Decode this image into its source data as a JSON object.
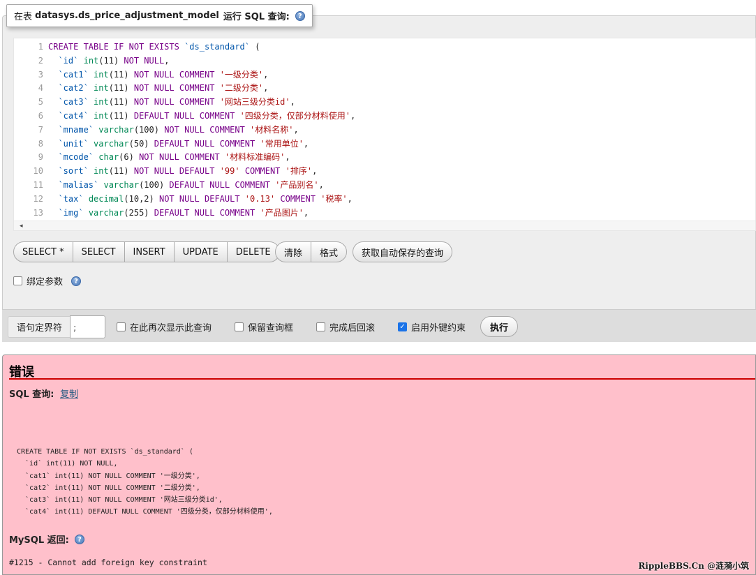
{
  "query_panel": {
    "legend_prefix": "在表",
    "table_name": "datasys.ds_price_adjustment_model",
    "legend_suffix": "运行 SQL 查询:",
    "help_icon": "help-icon"
  },
  "editor": {
    "lines": [
      {
        "n": "1",
        "t": [
          [
            "kw",
            "CREATE TABLE IF NOT EXISTS "
          ],
          [
            "idn",
            "`ds_standard`"
          ],
          [
            "pl",
            " ("
          ]
        ]
      },
      {
        "n": "2",
        "t": [
          [
            "pl",
            "  "
          ],
          [
            "idn",
            "`id`"
          ],
          [
            "pl",
            " "
          ],
          [
            "ty",
            "int"
          ],
          [
            "pl",
            "(11) "
          ],
          [
            "kw",
            "NOT NULL"
          ],
          [
            "pl",
            ","
          ]
        ]
      },
      {
        "n": "3",
        "t": [
          [
            "pl",
            "  "
          ],
          [
            "idn",
            "`cat1`"
          ],
          [
            "pl",
            " "
          ],
          [
            "ty",
            "int"
          ],
          [
            "pl",
            "(11) "
          ],
          [
            "kw",
            "NOT NULL COMMENT "
          ],
          [
            "str",
            "'一级分类'"
          ],
          [
            "pl",
            ","
          ]
        ]
      },
      {
        "n": "4",
        "t": [
          [
            "pl",
            "  "
          ],
          [
            "idn",
            "`cat2`"
          ],
          [
            "pl",
            " "
          ],
          [
            "ty",
            "int"
          ],
          [
            "pl",
            "(11) "
          ],
          [
            "kw",
            "NOT NULL COMMENT "
          ],
          [
            "str",
            "'二级分类'"
          ],
          [
            "pl",
            ","
          ]
        ]
      },
      {
        "n": "5",
        "t": [
          [
            "pl",
            "  "
          ],
          [
            "idn",
            "`cat3`"
          ],
          [
            "pl",
            " "
          ],
          [
            "ty",
            "int"
          ],
          [
            "pl",
            "(11) "
          ],
          [
            "kw",
            "NOT NULL COMMENT "
          ],
          [
            "str",
            "'网站三级分类id'"
          ],
          [
            "pl",
            ","
          ]
        ]
      },
      {
        "n": "6",
        "t": [
          [
            "pl",
            "  "
          ],
          [
            "idn",
            "`cat4`"
          ],
          [
            "pl",
            " "
          ],
          [
            "ty",
            "int"
          ],
          [
            "pl",
            "(11) "
          ],
          [
            "kw",
            "DEFAULT NULL COMMENT "
          ],
          [
            "str",
            "'四级分类，仅部分材料使用'"
          ],
          [
            "pl",
            ","
          ]
        ]
      },
      {
        "n": "7",
        "t": [
          [
            "pl",
            "  "
          ],
          [
            "idn",
            "`mname`"
          ],
          [
            "pl",
            " "
          ],
          [
            "ty",
            "varchar"
          ],
          [
            "pl",
            "(100) "
          ],
          [
            "kw",
            "NOT NULL COMMENT "
          ],
          [
            "str",
            "'材料名称'"
          ],
          [
            "pl",
            ","
          ]
        ]
      },
      {
        "n": "8",
        "t": [
          [
            "pl",
            "  "
          ],
          [
            "idn",
            "`unit`"
          ],
          [
            "pl",
            " "
          ],
          [
            "ty",
            "varchar"
          ],
          [
            "pl",
            "(50) "
          ],
          [
            "kw",
            "DEFAULT NULL COMMENT "
          ],
          [
            "str",
            "'常用单位'"
          ],
          [
            "pl",
            ","
          ]
        ]
      },
      {
        "n": "9",
        "t": [
          [
            "pl",
            "  "
          ],
          [
            "idn",
            "`mcode`"
          ],
          [
            "pl",
            " "
          ],
          [
            "ty",
            "char"
          ],
          [
            "pl",
            "(6) "
          ],
          [
            "kw",
            "NOT NULL COMMENT "
          ],
          [
            "str",
            "'材料标准编码'"
          ],
          [
            "pl",
            ","
          ]
        ]
      },
      {
        "n": "10",
        "t": [
          [
            "pl",
            "  "
          ],
          [
            "idn",
            "`sort`"
          ],
          [
            "pl",
            " "
          ],
          [
            "ty",
            "int"
          ],
          [
            "pl",
            "(11) "
          ],
          [
            "kw",
            "NOT NULL DEFAULT "
          ],
          [
            "str",
            "'99'"
          ],
          [
            "kw",
            " COMMENT "
          ],
          [
            "str",
            "'排序'"
          ],
          [
            "pl",
            ","
          ]
        ]
      },
      {
        "n": "11",
        "t": [
          [
            "pl",
            "  "
          ],
          [
            "idn",
            "`malias`"
          ],
          [
            "pl",
            " "
          ],
          [
            "ty",
            "varchar"
          ],
          [
            "pl",
            "(100) "
          ],
          [
            "kw",
            "DEFAULT NULL COMMENT "
          ],
          [
            "str",
            "'产品别名'"
          ],
          [
            "pl",
            ","
          ]
        ]
      },
      {
        "n": "12",
        "t": [
          [
            "pl",
            "  "
          ],
          [
            "idn",
            "`tax`"
          ],
          [
            "pl",
            " "
          ],
          [
            "ty",
            "decimal"
          ],
          [
            "pl",
            "(10,2) "
          ],
          [
            "kw",
            "NOT NULL DEFAULT "
          ],
          [
            "str",
            "'0.13'"
          ],
          [
            "kw",
            " COMMENT "
          ],
          [
            "str",
            "'税率'"
          ],
          [
            "pl",
            ","
          ]
        ]
      },
      {
        "n": "13",
        "t": [
          [
            "pl",
            "  "
          ],
          [
            "idn",
            "`img`"
          ],
          [
            "pl",
            " "
          ],
          [
            "ty",
            "varchar"
          ],
          [
            "pl",
            "(255) "
          ],
          [
            "kw",
            "DEFAULT NULL COMMENT "
          ],
          [
            "str",
            "'产品图片'"
          ],
          [
            "pl",
            ","
          ]
        ]
      }
    ],
    "scroll_arrow": "◂"
  },
  "buttons": {
    "select_star": "SELECT *",
    "select": "SELECT",
    "insert": "INSERT",
    "update": "UPDATE",
    "delete": "DELETE",
    "clear": "清除",
    "format": "格式",
    "get_autosaved": "获取自动保存的查询"
  },
  "bind_params": {
    "label": "绑定参数",
    "checked": false
  },
  "bottom_bar": {
    "delimiter_label": "语句定界符",
    "delimiter_value": ";",
    "show_query_again": "在此再次显示此查询",
    "keep_query_box": "保留查询框",
    "rollback_when_done": "完成后回滚",
    "enable_foreign_keys": "启用外键约束",
    "execute": "执行",
    "enable_foreign_keys_checked": true
  },
  "error": {
    "title": "错误",
    "sql_query_label": "SQL 查询:",
    "copy_link": "复制",
    "query_lines": [
      "CREATE TABLE IF NOT EXISTS `ds_standard` (",
      "  `id` int(11) NOT NULL,",
      "  `cat1` int(11) NOT NULL COMMENT '一级分类',",
      "  `cat2` int(11) NOT NULL COMMENT '二级分类',",
      "  `cat3` int(11) NOT NULL COMMENT '网站三级分类id',",
      "  `cat4` int(11) DEFAULT NULL COMMENT '四级分类，仅部分材料使用',"
    ],
    "mysql_returned_label": "MySQL 返回:",
    "message": "#1215 - Cannot add foreign key constraint",
    "background_color": "#ffc0cb",
    "rule_color": "#cc0000"
  },
  "watermark": "RippleBBS.Cn @涟漪小筑"
}
